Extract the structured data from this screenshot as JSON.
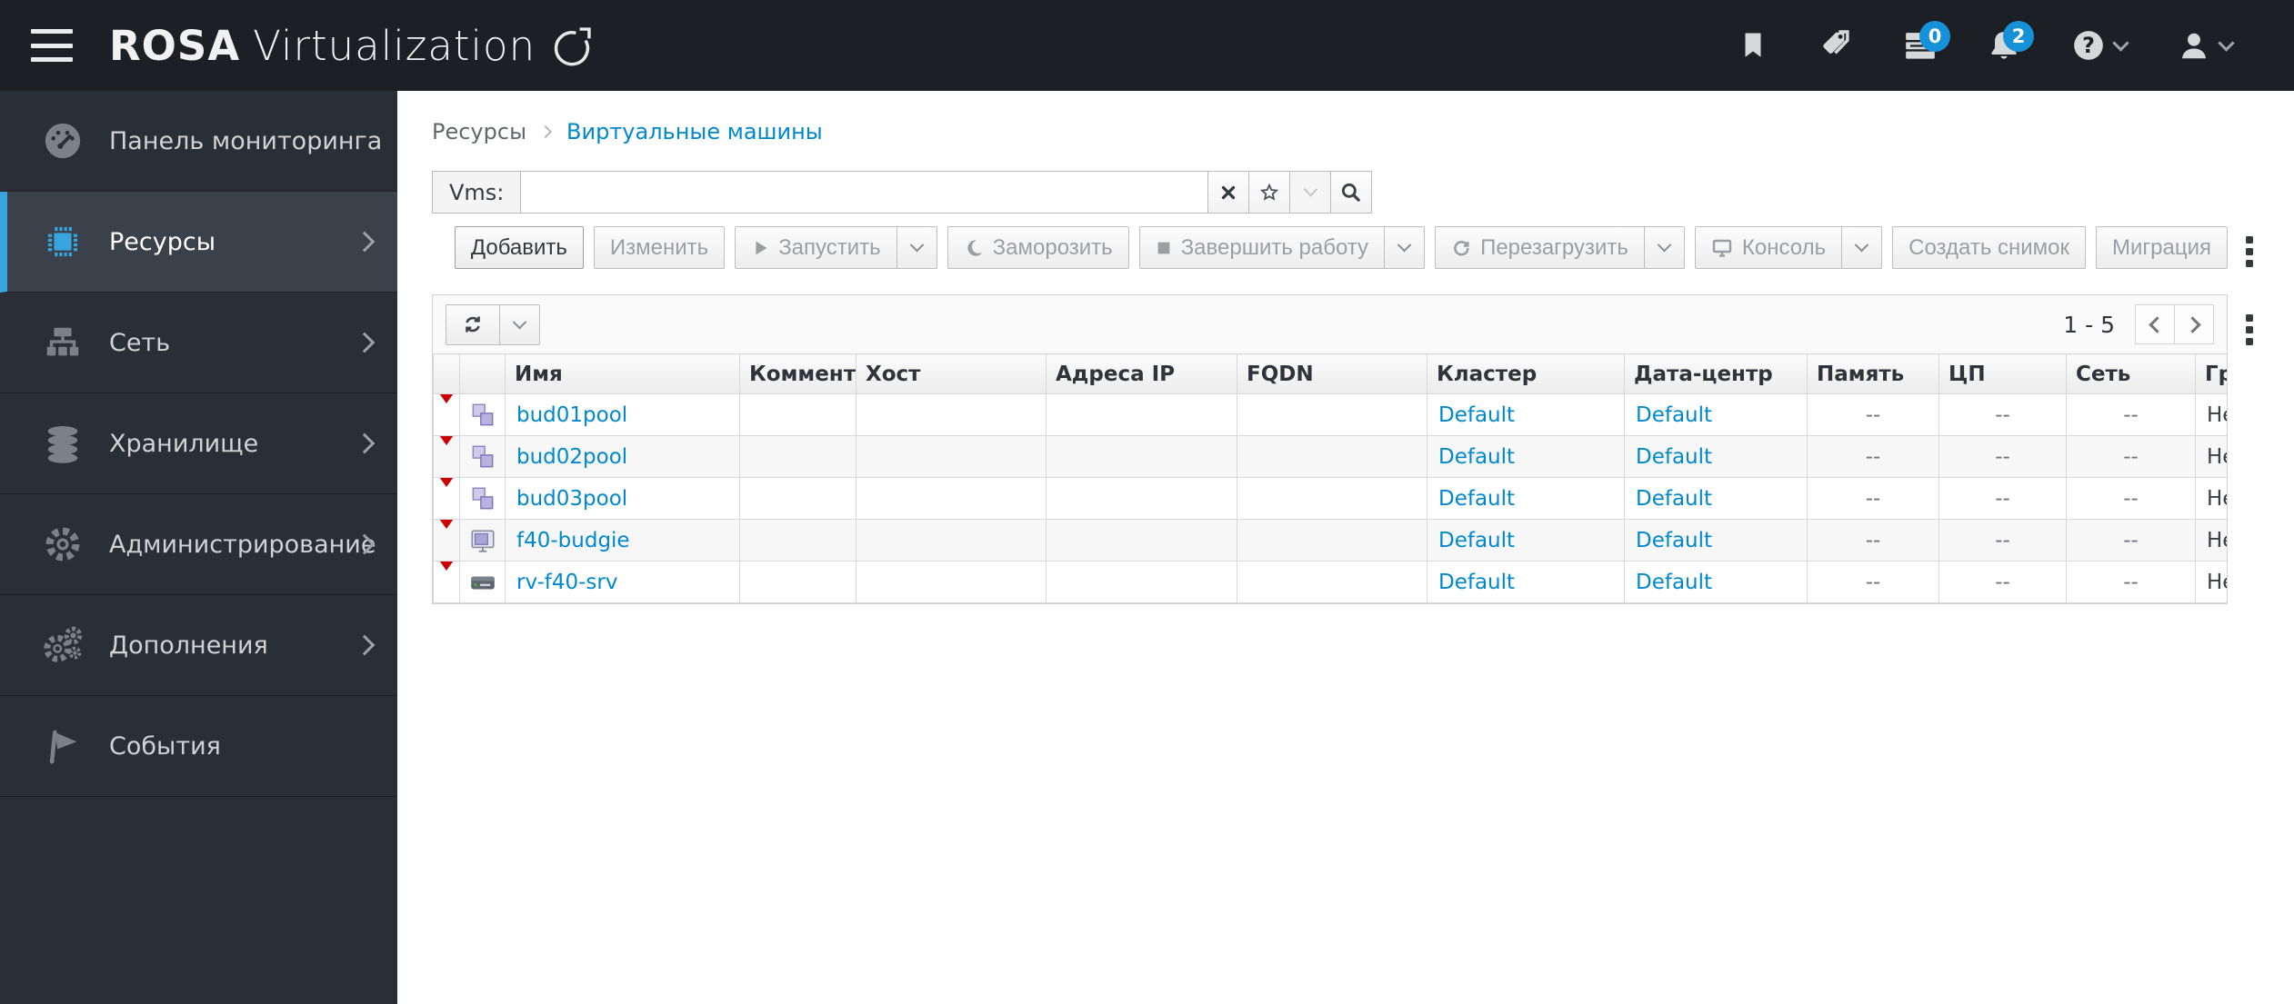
{
  "header": {
    "brand_bold": "ROSA",
    "brand_light": "Virtualization",
    "tasks_badge": "0",
    "alerts_badge": "2"
  },
  "sidebar": {
    "items": [
      {
        "label": "Панель мониторинга"
      },
      {
        "label": "Ресурсы"
      },
      {
        "label": "Сеть"
      },
      {
        "label": "Хранилище"
      },
      {
        "label": "Администрирование"
      },
      {
        "label": "Дополнения"
      },
      {
        "label": "События"
      }
    ]
  },
  "breadcrumb": {
    "parent": "Ресурсы",
    "current": "Виртуальные машины"
  },
  "search": {
    "label": "Vms:",
    "value": ""
  },
  "toolbar": {
    "add": "Добавить",
    "edit": "Изменить",
    "run": "Запустить",
    "suspend": "Заморозить",
    "shutdown": "Завершить работу",
    "reboot": "Перезагрузить",
    "console": "Консоль",
    "snapshot": "Создать снимок",
    "migrate": "Миграция"
  },
  "grid": {
    "range": "1 - 5",
    "columns": [
      "Имя",
      "Комментар",
      "Хост",
      "Адреса IP",
      "FQDN",
      "Кластер",
      "Дата-центр",
      "Память",
      "ЦП",
      "Сеть",
      "Графи"
    ],
    "rows": [
      {
        "name": "bud01pool",
        "comment": "",
        "host": "",
        "ip": "",
        "fqdn": "",
        "cluster": "Default",
        "datacenter": "Default",
        "memory": "--",
        "cpu": "--",
        "network": "--",
        "graphics": "Нет"
      },
      {
        "name": "bud02pool",
        "comment": "",
        "host": "",
        "ip": "",
        "fqdn": "",
        "cluster": "Default",
        "datacenter": "Default",
        "memory": "--",
        "cpu": "--",
        "network": "--",
        "graphics": "Нет"
      },
      {
        "name": "bud03pool",
        "comment": "",
        "host": "",
        "ip": "",
        "fqdn": "",
        "cluster": "Default",
        "datacenter": "Default",
        "memory": "--",
        "cpu": "--",
        "network": "--",
        "graphics": "Нет"
      },
      {
        "name": "f40-budgie",
        "comment": "",
        "host": "",
        "ip": "",
        "fqdn": "",
        "cluster": "Default",
        "datacenter": "Default",
        "memory": "--",
        "cpu": "--",
        "network": "--",
        "graphics": "Нет"
      },
      {
        "name": "rv-f40-srv",
        "comment": "",
        "host": "",
        "ip": "",
        "fqdn": "",
        "cluster": "Default",
        "datacenter": "Default",
        "memory": "--",
        "cpu": "--",
        "network": "--",
        "graphics": "Нет"
      }
    ]
  },
  "colors": {
    "accent": "#0088ce",
    "status_stopped": "#cc0000",
    "badge": "#1591d8",
    "sidebar_accent": "#3aa4dc"
  }
}
